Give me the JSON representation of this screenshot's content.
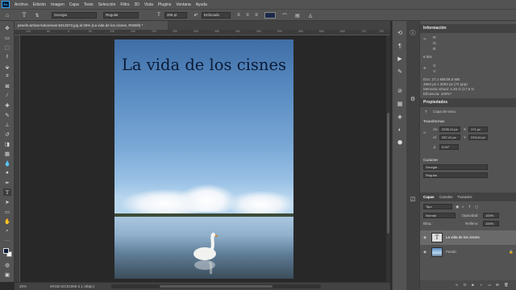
{
  "menu": [
    "Archivo",
    "Edición",
    "Imagen",
    "Capa",
    "Texto",
    "Selección",
    "Filtro",
    "3D",
    "Vista",
    "Plugins",
    "Ventana",
    "Ayuda"
  ],
  "app_logo": "Ps",
  "options_bar": {
    "font_family": "Georgia",
    "font_style": "Regular",
    "font_size": "206 pt",
    "aa_label": "aª",
    "antialias": "Enfocado",
    "text_color": "#1c2a4a"
  },
  "document_tab": "pexels-artiras-kokorevas-5212573.jpg al 25% (La vida de los cisnes, RGB/8) *",
  "ruler_ticks": [
    "100",
    "50",
    "0",
    "50",
    "100",
    "150",
    "200",
    "250",
    "300",
    "350",
    "400",
    "450",
    "500",
    "550",
    "600",
    "650",
    "700",
    "750"
  ],
  "document": {
    "title_text": "La vida de los cisnes"
  },
  "status": {
    "zoom": "25%",
    "profile": "sRGB IEC61966-2.1 (8bpc)"
  },
  "info_panel": {
    "title": "Información",
    "r_label": "R:",
    "g_label": "G:",
    "b_label": "B:",
    "bit": "8 bits",
    "x_label": "X:",
    "y_label": "Y:",
    "doc": "Doc: 27,1 MB/38,5 MB",
    "dims": "3664 px x 3052 px (72 ppp)",
    "mem": "Memoria virtual: 4,45 G (17,5 G",
    "eff": "Eficiencia: 100%*"
  },
  "properties_panel": {
    "title": "Propiedades",
    "layer_kind": "Capa de texto",
    "transform_title": "Transformar",
    "w_label": "An",
    "w": "2235,11 px",
    "x_label": "X",
    "x": "171 px",
    "h_label": "Al",
    "h": "287,41 px",
    "y_label": "Y",
    "y": "219,41 px",
    "angle": "0,00°",
    "char_title": "Carácter",
    "font": "Georgia",
    "style": "Regular"
  },
  "layers_panel": {
    "tabs": [
      "Capas",
      "Canales",
      "Trazados"
    ],
    "filter": "Tipo",
    "blend_mode": "Normal",
    "opacity_label": "Opacidad:",
    "opacity": "100%",
    "lock_label": "Bloq.:",
    "fill_label": "Relleno:",
    "fill": "100%",
    "layers": [
      {
        "name": "La vida de los cisnes",
        "kind": "text"
      },
      {
        "name": "Fondo",
        "kind": "image"
      }
    ]
  },
  "icons": {
    "home": "home-icon",
    "type_tool": "type-tool-icon",
    "swan_doc": "swan-photo"
  },
  "colors": {
    "accent": "#31a8ff",
    "chrome": "#535353",
    "canvas": "#282828",
    "title_color": "#0b1a36"
  }
}
